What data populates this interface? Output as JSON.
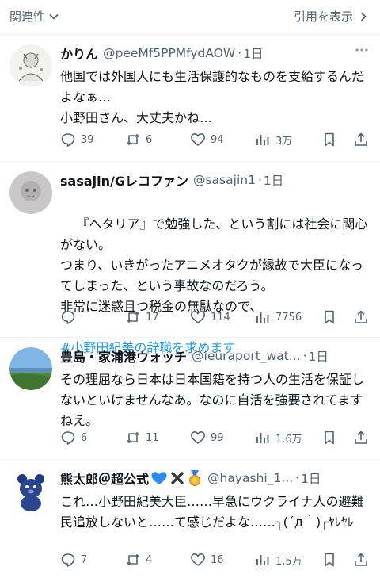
{
  "topbar": {
    "sort_label": "関連性",
    "quotes_label": "引用を表示"
  },
  "tweets": [
    {
      "name": "かりん",
      "handle": "@peeMf5PPMfydAOW",
      "time": "1日",
      "text": "他国では外国人にも生活保護的なものを支給するんだよなぁ…\n小野田さん、大丈夫かね…",
      "replies": "39",
      "reposts": "6",
      "likes": "94",
      "views": "3万"
    },
    {
      "name": "sasajin/Gレコファン",
      "handle": "@sasajin1",
      "time": "1日",
      "text": "『ヘタリア』で勉強した、という割には社会に関心がない。\nつまり、いきがったアニメオタクが縁故で大臣になってしまった、という事故なのだろう。\n非常に迷惑且つ税金の無駄なので、",
      "hashtag": "#小野田紀美の辞職を求めます",
      "replies": "",
      "reposts": "17",
      "likes": "114",
      "views": "7756"
    },
    {
      "name": "豊島・家浦港ウォッチ",
      "handle": "@ieuraport_wat...",
      "time": "1日",
      "text": "その理屈なら日本は日本国籍を持つ人の生活を保証しないといけませんなあ。なのに自活を強要されてますねえ。",
      "replies": "6",
      "reposts": "11",
      "likes": "99",
      "views": "1.6万"
    },
    {
      "name": "熊太郎＠超公式",
      "handle": "@hayashi_1...",
      "time": "1日",
      "text": "これ…小野田紀美大臣……早急にウクライナ人の避難民追放しないと……て感じだよな……┐(´д｀)┌ﾔﾚﾔﾚ",
      "replies": "7",
      "reposts": "4",
      "likes": "16",
      "views": "1.5万"
    }
  ],
  "colors": {
    "text": "#0f1419",
    "secondary": "#536471",
    "link": "#1d9bf0",
    "divider": "#eff3f4"
  }
}
